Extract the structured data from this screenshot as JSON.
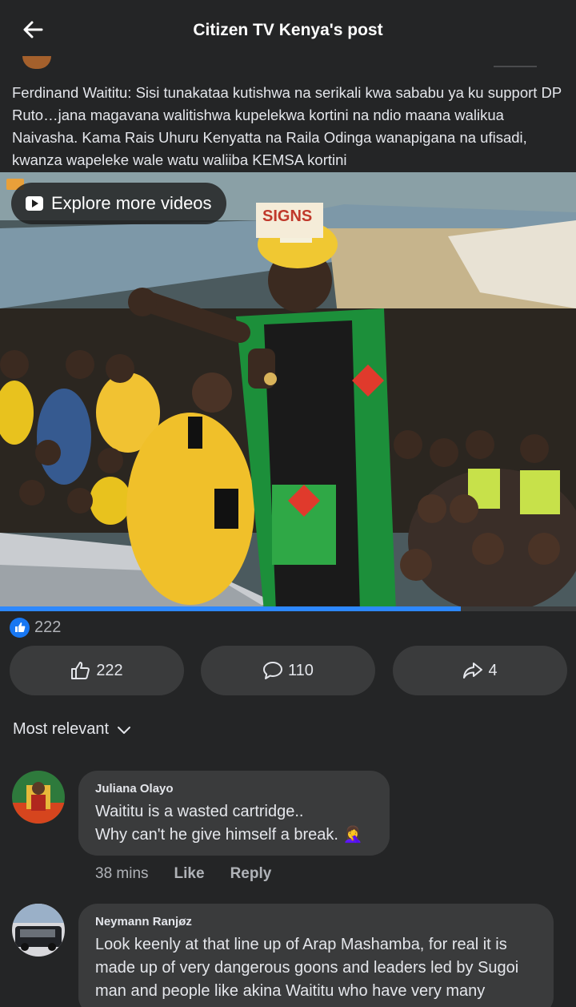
{
  "header": {
    "back_icon": "arrow-left-icon",
    "title": "Citizen TV Kenya's post"
  },
  "post": {
    "text": "Ferdinand Waititu: Sisi tunakataa kutishwa na serikali kwa sababu ya ku support DP Ruto…jana magavana walitishwa kupelekwa kortini na ndio maana walikua Naivasha. Kama Rais Uhuru Kenyatta na Raila Odinga wanapigana na ufisadi, kwanza wapeleke wale watu waliiba KEMSA kortini"
  },
  "video": {
    "explore_label": "Explore more videos",
    "sign_text": "SIGNS",
    "progress": 0.8
  },
  "reactions": {
    "icon": "like-icon",
    "count": "222"
  },
  "actions": {
    "like_count": "222",
    "comment_count": "110",
    "share_count": "4"
  },
  "sort": {
    "label": "Most relevant",
    "icon": "chevron-down-icon"
  },
  "comments": [
    {
      "author": "Juliana Olayo",
      "line1": "Waititu is a wasted cartridge..",
      "line2": "Why can't he give himself a break.",
      "emoji": "🤦‍♀️",
      "time": "38 mins",
      "like_label": "Like",
      "reply_label": "Reply"
    },
    {
      "author": "Neymann Ranjøz",
      "text": "Look keenly at that line up of Arap Mashamba, for real it is made up of very dangerous goons and leaders led by Sugoi man and people like akina Waititu who have very many"
    }
  ],
  "colors": {
    "background": "#242526",
    "surface": "#3a3b3c",
    "accent": "#1877f2",
    "text": "#e4e6eb",
    "muted": "#b0b3b8"
  }
}
